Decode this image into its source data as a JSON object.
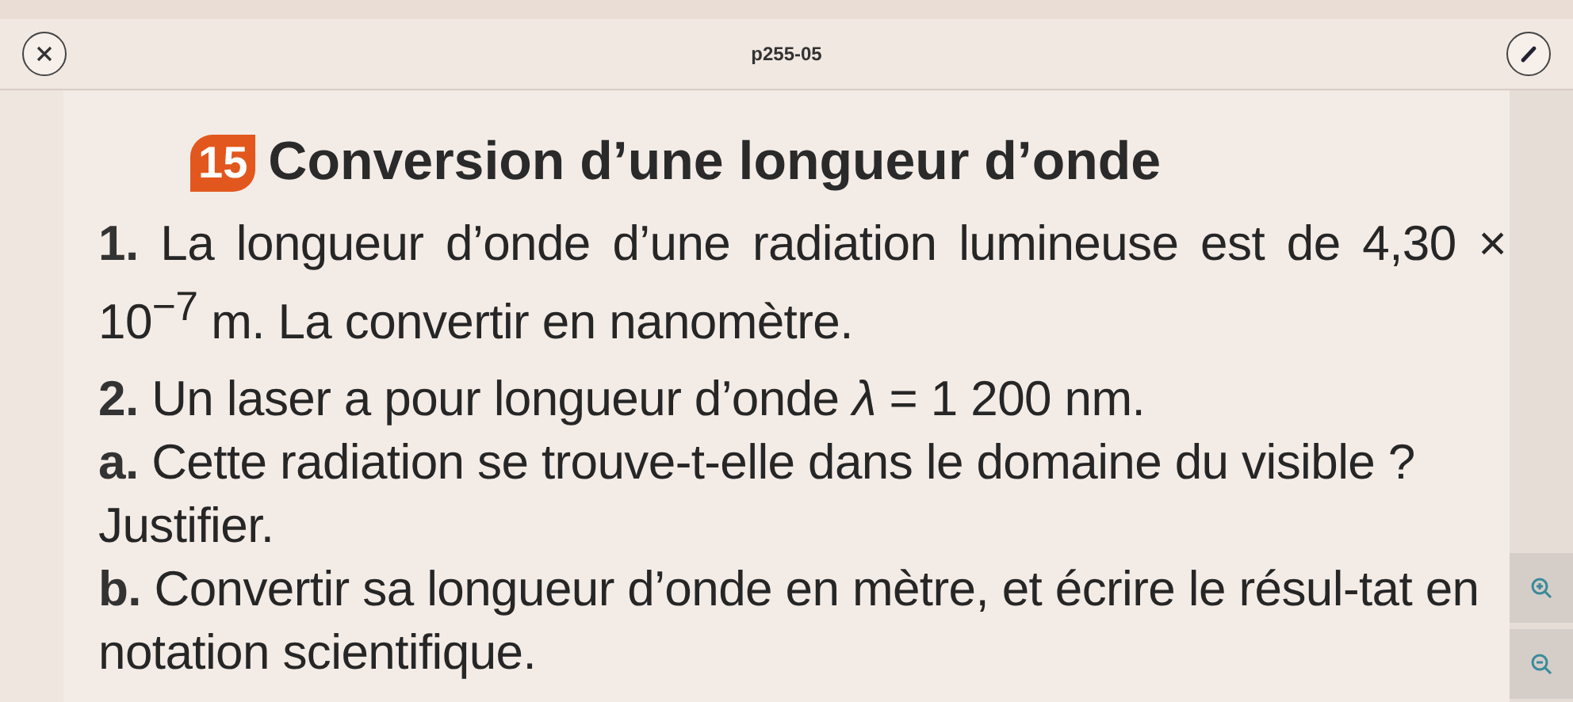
{
  "header": {
    "title": "p255-05"
  },
  "exercise": {
    "number": "15",
    "title": "Conversion d’une longueur d’onde",
    "paragraphs": [
      {
        "kind": "justified",
        "text": "**1.** La longueur d’onde d’une radiation lumineuse est de 4,30 × 10$^{−7}$ m. La convertir en nanomètre."
      },
      {
        "kind": "plain",
        "text": "**2.** Un laser a pour longueur d’onde *λ* = 1 200 nm."
      },
      {
        "kind": "plain",
        "text": "**a.** Cette radiation se trouve-t-elle dans le domaine du visible ? Justifier."
      },
      {
        "kind": "plain",
        "text": "**b.** Convertir sa longueur d’onde en mètre, et écrire le résul-tat en notation scientifique."
      }
    ]
  }
}
